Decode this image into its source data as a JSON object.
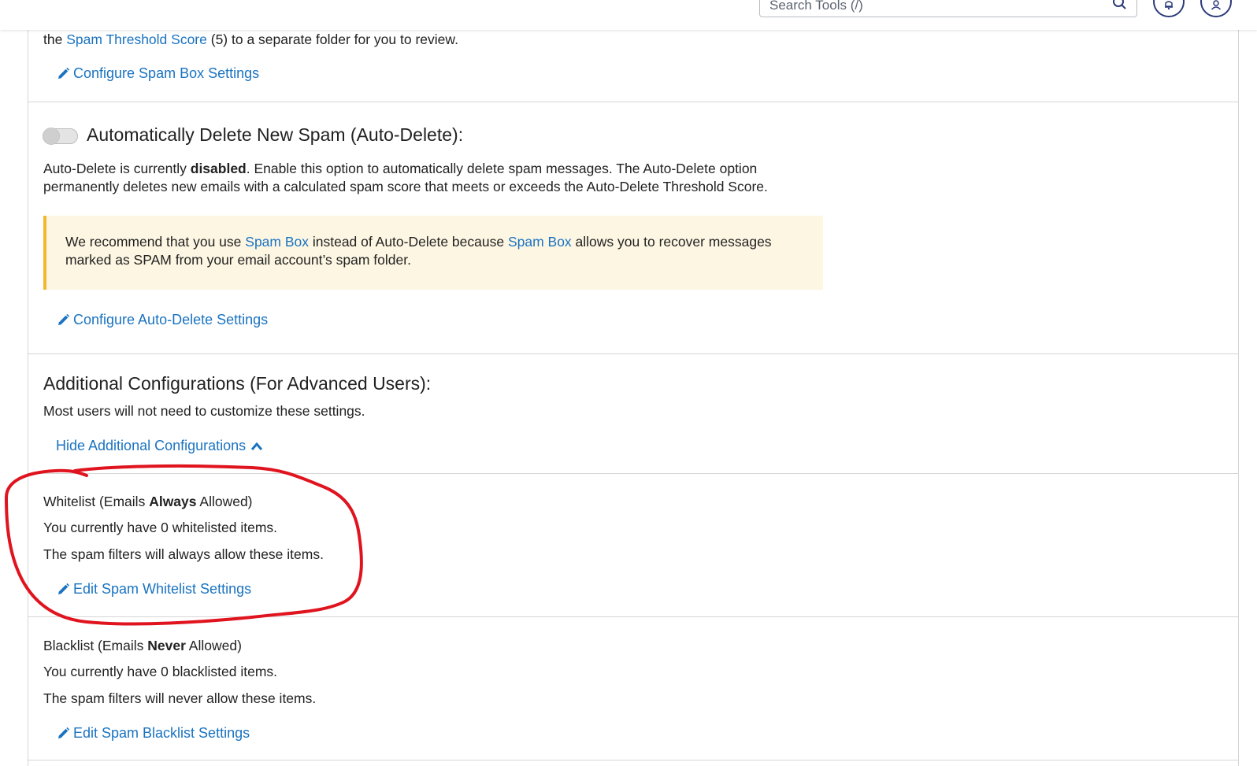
{
  "topbar": {
    "search_placeholder": "Search Tools (/)",
    "search_icon": "magnifier-icon",
    "notifications_icon": "bell-icon",
    "user_icon": "user-icon"
  },
  "spam_box": {
    "text_before": "the ",
    "link_text": "Spam Threshold Score",
    "text_after": " (5) to a separate folder for you to review.",
    "action_label": "Configure Spam Box Settings"
  },
  "auto_delete": {
    "title": "Automatically Delete New Spam (Auto-Delete):",
    "status_prefix": "Auto-Delete is currently ",
    "status_value": "disabled",
    "status_suffix": ". Enable this option to automatically delete spam messages. The Auto-Delete option permanently deletes new emails with a calculated spam score that meets or exceeds the Auto-Delete Threshold Score.",
    "toggle_on": false,
    "callout": {
      "part1": "We recommend that you use ",
      "link1": "Spam Box",
      "part2": " instead of Auto-Delete because ",
      "link2": "Spam Box",
      "part3": " allows you to recover messages marked as SPAM from your email account’s spam folder."
    },
    "action_label": "Configure Auto-Delete Settings"
  },
  "additional": {
    "title": "Additional Configurations (For Advanced Users):",
    "description": "Most users will not need to customize these settings.",
    "toggle_label": "Hide Additional Configurations"
  },
  "whitelist": {
    "title_prefix": "Whitelist (Emails ",
    "title_bold": "Always",
    "title_suffix": " Allowed)",
    "count_text": "You currently have 0 whitelisted items.",
    "description": "The spam filters will always allow these items.",
    "action_label": "Edit Spam Whitelist Settings"
  },
  "blacklist": {
    "title_prefix": "Blacklist (Emails ",
    "title_bold": "Never",
    "title_suffix": " Allowed)",
    "count_text": "You currently have 0 blacklisted items.",
    "description": "The spam filters will never allow these items.",
    "action_label": "Edit Spam Blacklist Settings"
  },
  "colors": {
    "link": "#1a73c1",
    "callout_bg": "#fdf6e3",
    "callout_border": "#f2b632",
    "annotation": "#e0141e"
  }
}
